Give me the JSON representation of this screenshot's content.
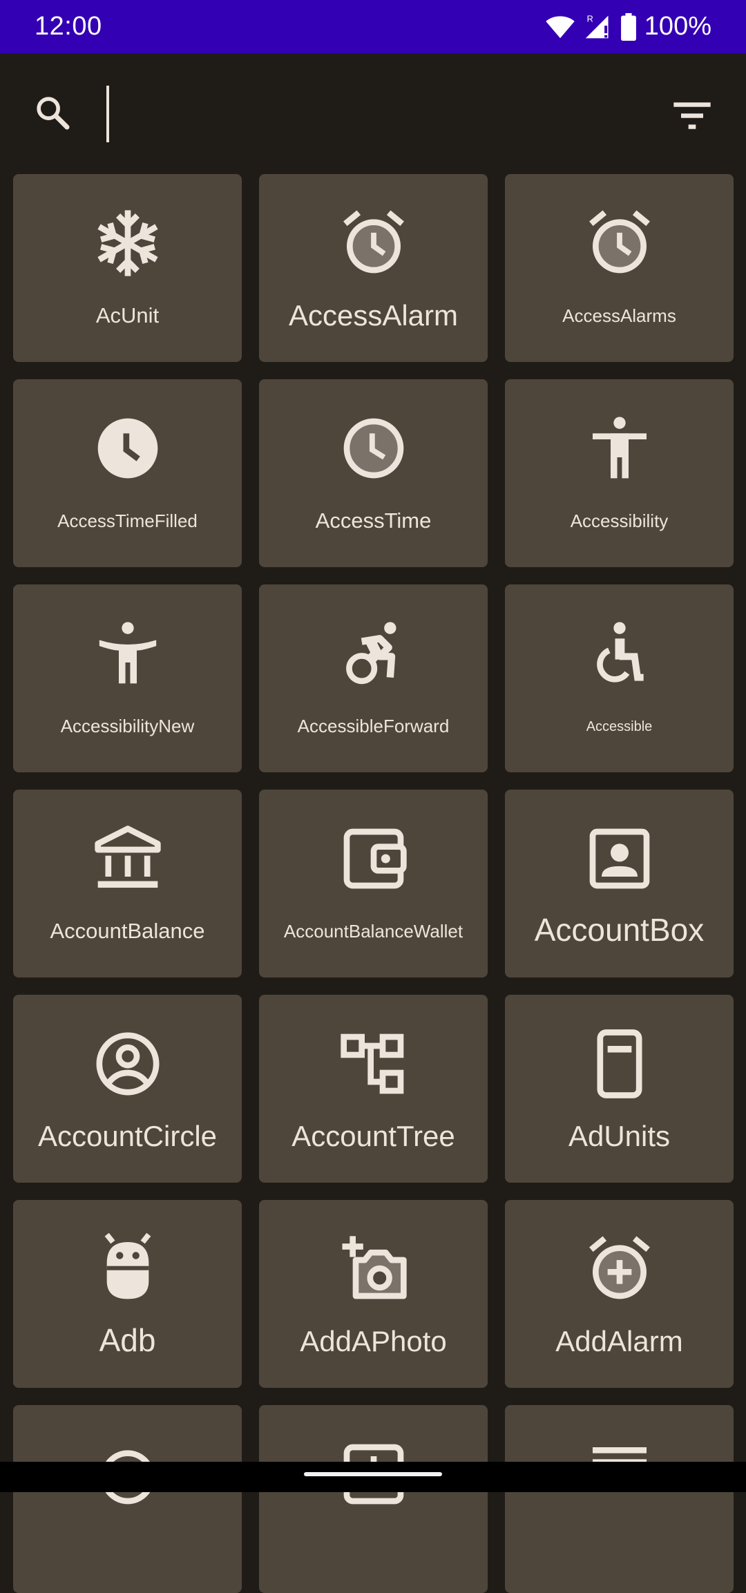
{
  "status_bar": {
    "time": "12:00",
    "battery": "100%",
    "network_label": "R"
  },
  "search": {
    "value": "",
    "placeholder": ""
  },
  "tiles": [
    {
      "label": "AcUnit",
      "icon": "ac-unit-icon"
    },
    {
      "label": "AccessAlarm",
      "icon": "access-alarm-icon"
    },
    {
      "label": "AccessAlarms",
      "icon": "access-alarms-icon"
    },
    {
      "label": "AccessTimeFilled",
      "icon": "access-time-filled-icon"
    },
    {
      "label": "AccessTime",
      "icon": "access-time-icon"
    },
    {
      "label": "Accessibility",
      "icon": "accessibility-icon"
    },
    {
      "label": "AccessibilityNew",
      "icon": "accessibility-new-icon"
    },
    {
      "label": "AccessibleForward",
      "icon": "accessible-forward-icon"
    },
    {
      "label": "Accessible",
      "icon": "accessible-icon"
    },
    {
      "label": "AccountBalance",
      "icon": "account-balance-icon"
    },
    {
      "label": "AccountBalanceWallet",
      "icon": "account-balance-wallet-icon"
    },
    {
      "label": "AccountBox",
      "icon": "account-box-icon"
    },
    {
      "label": "AccountCircle",
      "icon": "account-circle-icon"
    },
    {
      "label": "AccountTree",
      "icon": "account-tree-icon"
    },
    {
      "label": "AdUnits",
      "icon": "ad-units-icon"
    },
    {
      "label": "Adb",
      "icon": "adb-icon"
    },
    {
      "label": "AddAPhoto",
      "icon": "add-a-photo-icon"
    },
    {
      "label": "AddAlarm",
      "icon": "add-alarm-icon"
    }
  ],
  "colors": {
    "status_bar": "#3300b3",
    "background": "#1f1c18",
    "tile": "#4f463b",
    "foreground": "#ede4dc"
  }
}
